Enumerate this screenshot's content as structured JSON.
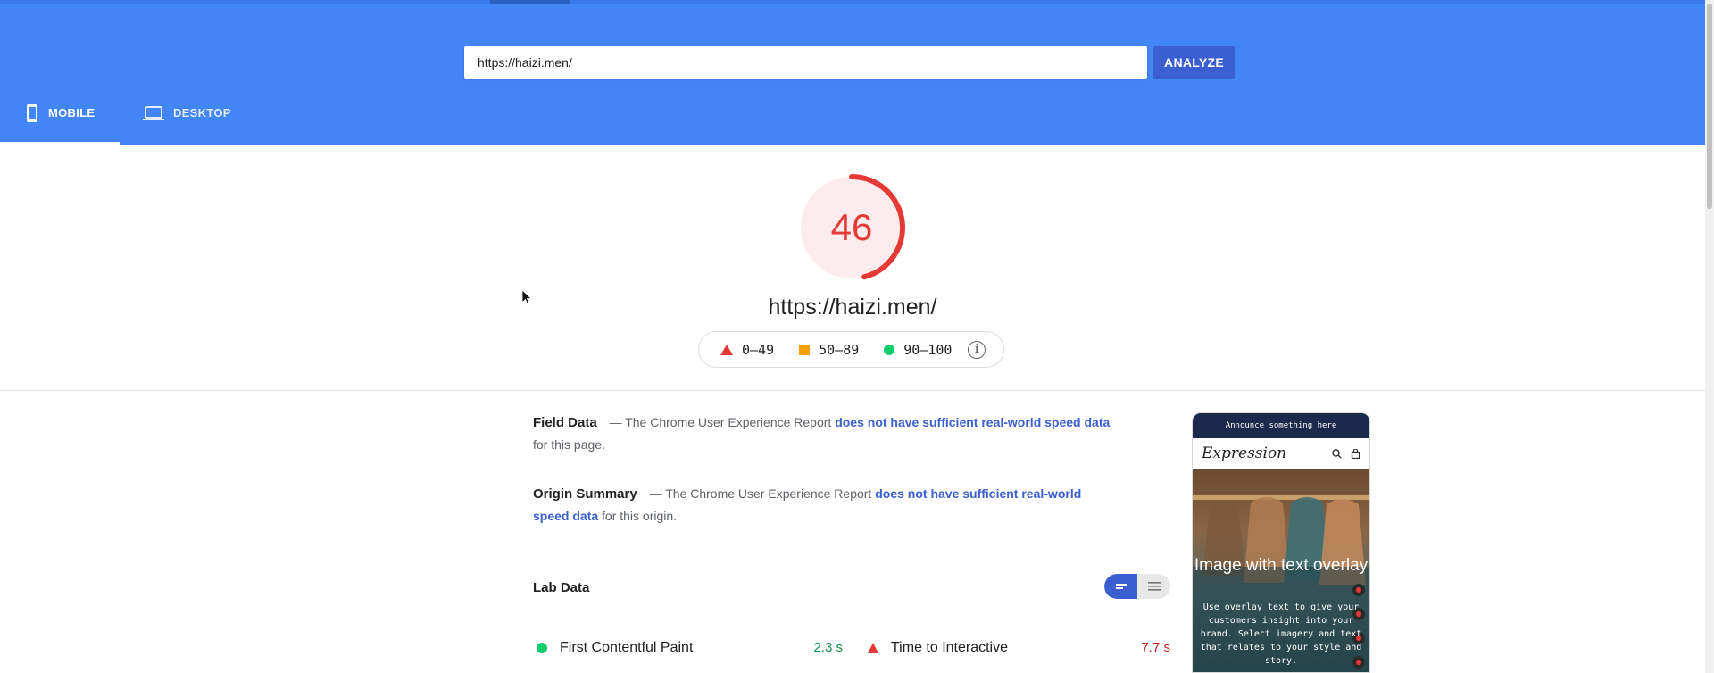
{
  "search": {
    "url_value": "https://haizi.men/",
    "analyze_label": "ANALYZE"
  },
  "tabs": [
    {
      "label": "MOBILE",
      "icon": "phone-icon",
      "active": true
    },
    {
      "label": "DESKTOP",
      "icon": "laptop-icon",
      "active": false
    }
  ],
  "score": {
    "value": "46",
    "fraction": 0.46,
    "color": "#e53935",
    "url": "https://haizi.men/"
  },
  "legend": {
    "fail": "0–49",
    "average": "50–89",
    "pass": "90–100",
    "fail_color": "#e53935",
    "average_color": "#f4a000",
    "pass_color": "#0cce6b",
    "info_icon": "info-icon"
  },
  "field_data": {
    "title": "Field Data",
    "prefix": "— The Chrome User Experience Report",
    "link": "does not have sufficient real-world speed data",
    "suffix": "for this page."
  },
  "origin_summary": {
    "title": "Origin Summary",
    "prefix": "— The Chrome User Experience Report",
    "link": "does not have sufficient real-world speed data",
    "suffix": "for this origin."
  },
  "lab_data": {
    "title": "Lab Data",
    "metrics": [
      {
        "label": "First Contentful Paint",
        "value": "2.3 s",
        "status": "pass",
        "color": "#0d904f"
      },
      {
        "label": "Time to Interactive",
        "value": "7.7 s",
        "status": "fail",
        "color": "#c5221f"
      }
    ]
  },
  "preview": {
    "announcement": "Announce something here",
    "logo": "Expression",
    "hero_title": "Image with text overlay",
    "hero_body": "Use overlay text to give your customers insight into your brand. Select imagery and text that relates to your style and story."
  }
}
